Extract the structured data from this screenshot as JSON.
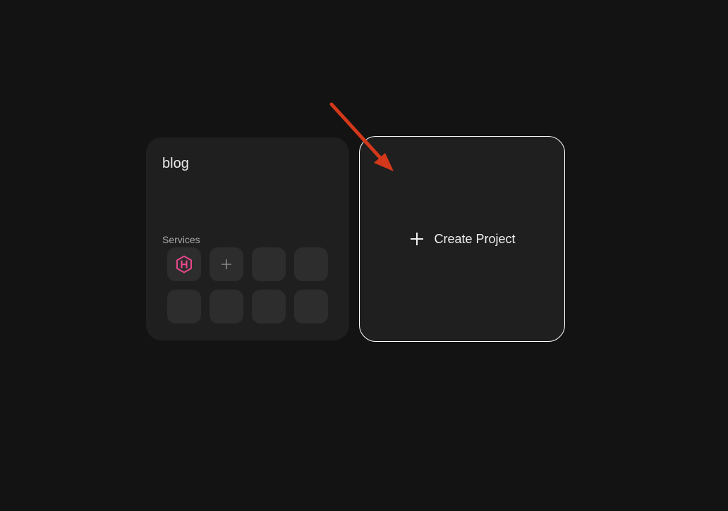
{
  "project": {
    "name": "blog",
    "services_label": "Services"
  },
  "services": [
    {
      "icon": "hasura-icon",
      "color": "#e9478b"
    },
    {
      "icon": "plus-icon"
    },
    {
      "icon": null
    },
    {
      "icon": null
    },
    {
      "icon": null
    },
    {
      "icon": null
    },
    {
      "icon": null
    },
    {
      "icon": null
    }
  ],
  "create": {
    "label": "Create Project",
    "icon": "plus-icon"
  },
  "annotation": {
    "icon": "arrow-icon",
    "color": "#d4381a"
  }
}
